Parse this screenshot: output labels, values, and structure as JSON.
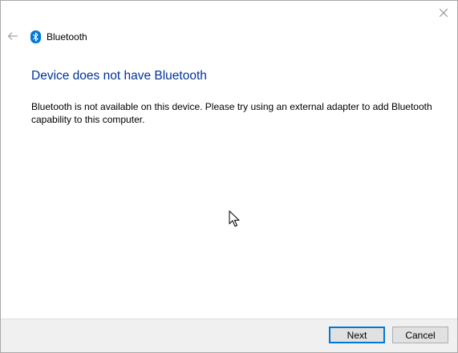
{
  "window": {
    "header_title": "Bluetooth",
    "close_icon": "close-icon",
    "back_icon": "back-arrow-icon"
  },
  "content": {
    "heading": "Device does not have Bluetooth",
    "message": "Bluetooth is not available on this device. Please try using an external adapter to add Bluetooth capability to this computer."
  },
  "footer": {
    "next_label": "Next",
    "cancel_label": "Cancel"
  },
  "colors": {
    "heading": "#003399",
    "bluetooth_icon": "#0078d7",
    "focus_border": "#0078d7",
    "footer_bg": "#f0f0f0"
  }
}
